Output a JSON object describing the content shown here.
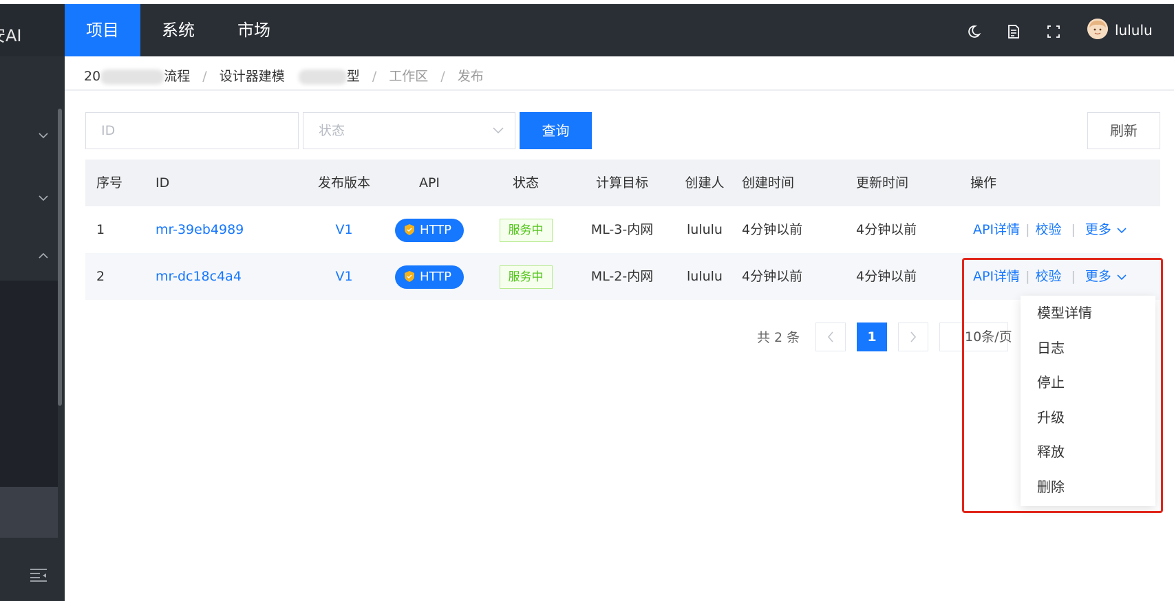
{
  "sidebar": {
    "logo_text": "安AI",
    "collapse_icon": "menu-fold-icon"
  },
  "topbar": {
    "tabs": [
      {
        "label": "项目",
        "active": true
      },
      {
        "label": "系统",
        "active": false
      },
      {
        "label": "市场",
        "active": false
      }
    ],
    "icons": [
      "moon-icon",
      "document-icon",
      "fullscreen-icon"
    ],
    "username": "lululu"
  },
  "breadcrumb": {
    "items": [
      "20",
      "流程",
      "设计器建模",
      "型",
      "工作区",
      "发布"
    ]
  },
  "filters": {
    "id_placeholder": "ID",
    "status_placeholder": "状态",
    "query_label": "查询",
    "refresh_label": "刷新"
  },
  "table": {
    "columns": [
      "序号",
      "ID",
      "发布版本",
      "API",
      "状态",
      "计算目标",
      "创建人",
      "创建时间",
      "更新时间",
      "操作"
    ],
    "rows": [
      {
        "index": "1",
        "id": "mr-39eb4989",
        "version": "V1",
        "api": "HTTP",
        "status": "服务中",
        "target": "ML-3-内网",
        "creator": "lululu",
        "created": "4分钟以前",
        "updated": "4分钟以前"
      },
      {
        "index": "2",
        "id": "mr-dc18c4a4",
        "version": "V1",
        "api": "HTTP",
        "status": "服务中",
        "target": "ML-2-内网",
        "creator": "lululu",
        "created": "4分钟以前",
        "updated": "4分钟以前"
      }
    ],
    "actions": {
      "api_detail": "API详情",
      "verify": "校验",
      "more": "更多"
    }
  },
  "pagination": {
    "total": "共 2 条",
    "current_page": "1",
    "page_size": "10条/页"
  },
  "dropdown": {
    "items": [
      "模型详情",
      "日志",
      "停止",
      "升级",
      "释放",
      "删除"
    ]
  },
  "colors": {
    "primary": "#1677ff",
    "header_bg": "#2a2f36",
    "status_green": "#52c41a",
    "annotation_red": "#e0261b"
  }
}
